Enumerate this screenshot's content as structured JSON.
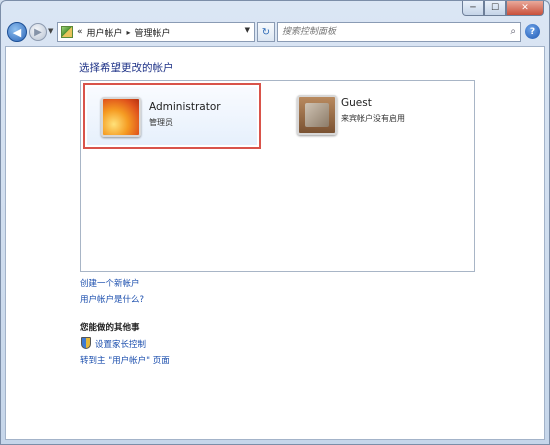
{
  "breadcrumb": {
    "overflow": "«",
    "items": [
      "用户帐户",
      "管理帐户"
    ],
    "separator": "▸"
  },
  "search": {
    "placeholder": "搜索控制面板"
  },
  "icons": {
    "back": "back-arrow-icon",
    "forward": "forward-arrow-icon",
    "refresh": "refresh-icon",
    "search": "search-icon",
    "help": "help-icon",
    "shield": "shield-icon"
  },
  "help": {
    "label": "?"
  },
  "caption": {
    "minimize": "─",
    "maximize": "☐",
    "close": "✕"
  },
  "main": {
    "title": "选择希望更改的帐户",
    "accounts": [
      {
        "name": "Administrator",
        "role": "管理员",
        "selected": true
      },
      {
        "name": "Guest",
        "role": "来宾帐户没有启用",
        "selected": false
      }
    ],
    "links": [
      "创建一个新帐户",
      "用户帐户是什么?"
    ],
    "section_title": "您能做的其他事",
    "section_links": [
      "设置家长控制",
      "转到主 \"用户帐户\" 页面"
    ]
  },
  "colors": {
    "link": "#1c4fae",
    "title": "#1e3287",
    "selection_border": "#d9534a"
  }
}
